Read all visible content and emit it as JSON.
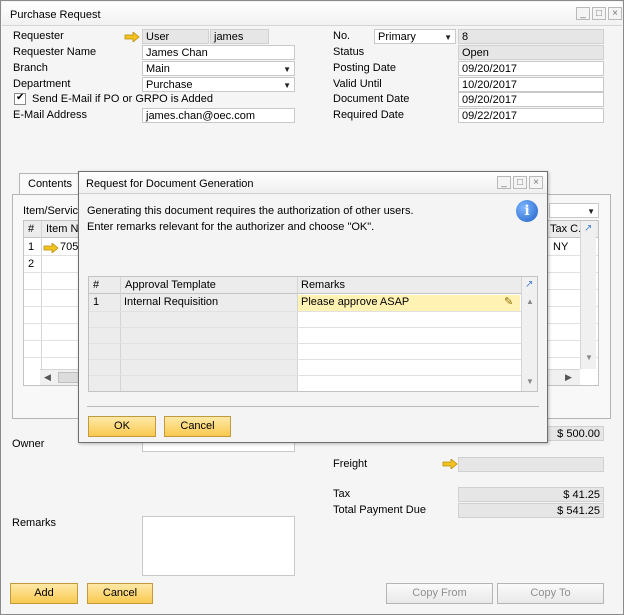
{
  "window": {
    "title": "Purchase Request"
  },
  "left_fields": {
    "requester": {
      "label": "Requester",
      "type_value": "User",
      "value": "james"
    },
    "requester_name": {
      "label": "Requester Name",
      "value": "James Chan"
    },
    "branch": {
      "label": "Branch",
      "value": "Main"
    },
    "department": {
      "label": "Department",
      "value": "Purchase"
    },
    "send_email": {
      "label": "Send E-Mail if PO or GRPO is Added",
      "checked": true
    },
    "email": {
      "label": "E-Mail Address",
      "value": "james.chan@oec.com"
    }
  },
  "right_fields": {
    "no": {
      "label": "No.",
      "series": "Primary",
      "value": "8"
    },
    "status": {
      "label": "Status",
      "value": "Open"
    },
    "posting_date": {
      "label": "Posting Date",
      "value": "09/20/2017"
    },
    "valid_until": {
      "label": "Valid Until",
      "value": "10/20/2017"
    },
    "document_date": {
      "label": "Document Date",
      "value": "09/20/2017"
    },
    "required_date": {
      "label": "Required Date",
      "value": "09/22/2017"
    }
  },
  "tabs": {
    "contents": "Contents"
  },
  "content": {
    "item_service_label": "Item/Service",
    "grid_headers": {
      "num": "#",
      "item_no": "Item No.",
      "tax_code": "Tax C..."
    },
    "rows": [
      {
        "num": "1",
        "item_no": "705",
        "tax_code": "NY"
      },
      {
        "num": "2",
        "item_no": "",
        "tax_code": ""
      }
    ]
  },
  "totals": {
    "before_discount_value": "$ 500.00",
    "freight_label": "Freight",
    "tax_label": "Tax",
    "tax_value": "$ 41.25",
    "total_label": "Total Payment Due",
    "total_value": "$ 541.25"
  },
  "bottom": {
    "owner_label": "Owner",
    "remarks_label": "Remarks",
    "add_button": "Add",
    "cancel_button": "Cancel",
    "copy_from_button": "Copy From",
    "copy_to_button": "Copy To"
  },
  "dialog": {
    "title": "Request for Document Generation",
    "message_line1": "Generating this document requires the authorization of other users.",
    "message_line2": "Enter remarks relevant for the authorizer and choose \"OK\".",
    "headers": {
      "num": "#",
      "template": "Approval Template",
      "remarks": "Remarks"
    },
    "rows": [
      {
        "num": "1",
        "template": "Internal Requisition",
        "remarks": "Please approve ASAP"
      }
    ],
    "ok_button": "OK",
    "cancel_button": "Cancel"
  },
  "colors": {
    "accent_yellow": "#f8c94f",
    "selected_row": "#fff2b3",
    "arrow": "#f2c21f",
    "info_blue": "#1e5fc7"
  }
}
